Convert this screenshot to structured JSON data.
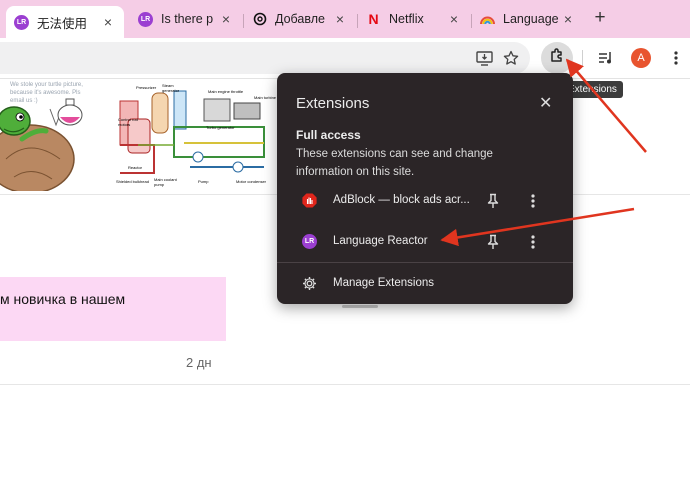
{
  "tabs": [
    {
      "title": "无法使用",
      "icon": "language-reactor-icon",
      "active": true
    },
    {
      "title": "Is there p",
      "icon": "language-reactor-icon",
      "active": false
    },
    {
      "title": "Добавле",
      "icon": "chatgpt-icon",
      "active": false
    },
    {
      "title": "Netflix",
      "icon": "netflix-icon",
      "active": false
    },
    {
      "title": "Language",
      "icon": "rainbow-icon",
      "active": false
    }
  ],
  "toolbar": {
    "avatar_letter": "A",
    "tooltip": "Extensions"
  },
  "page": {
    "image_caption": "We stole your turtle picture, because it's awesome. Pls email us :)",
    "diagram_labels": [
      "Pressurizer",
      "Steam generator",
      "Main engine throttle",
      "Main turbine",
      "Turbo generator",
      "Control rod motors",
      "Reactor",
      "Shielded bulkhead",
      "Main coolant pump",
      "Pump",
      "Motor condenser"
    ],
    "banner_text": "м новичка в нашем",
    "post_age": "2 дн"
  },
  "popup": {
    "title": "Extensions",
    "section_title": "Full access",
    "section_desc": "These extensions can see and change information on this site.",
    "extensions": [
      {
        "name": "AdBlock — block ads acr...",
        "icon": "adblock-icon"
      },
      {
        "name": "Language Reactor",
        "icon": "language-reactor-icon"
      }
    ],
    "manage_label": "Manage Extensions"
  },
  "colors": {
    "tab_strip": "#f5cde6",
    "popup_bg": "#2b2527",
    "arrow": "#e0351f",
    "banner": "#fcd8f4"
  }
}
